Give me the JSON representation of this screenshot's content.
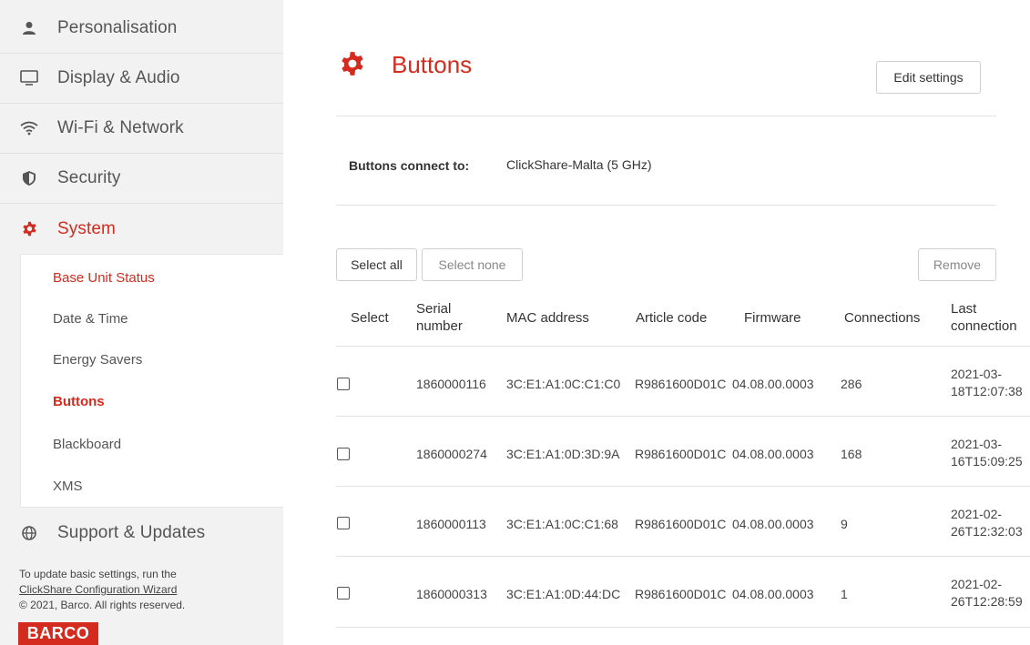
{
  "sidebar": {
    "nav": [
      {
        "label": "Personalisation",
        "icon": "person-icon"
      },
      {
        "label": "Display & Audio",
        "icon": "monitor-icon"
      },
      {
        "label": "Wi-Fi & Network",
        "icon": "wifi-icon"
      },
      {
        "label": "Security",
        "icon": "shield-icon"
      },
      {
        "label": "System",
        "icon": "gear-icon"
      }
    ],
    "submenu": [
      {
        "label": "Base Unit Status"
      },
      {
        "label": "Date & Time"
      },
      {
        "label": "Energy Savers"
      },
      {
        "label": "Buttons"
      },
      {
        "label": "Blackboard"
      },
      {
        "label": "XMS"
      }
    ],
    "support": {
      "label": "Support & Updates",
      "icon": "globe-icon"
    },
    "footer": {
      "line1": "To update basic settings, run the",
      "link": "ClickShare Configuration Wizard",
      "copyright": "© 2021, Barco. All rights reserved.",
      "logo": "BARCO"
    }
  },
  "main": {
    "title": "Buttons",
    "edit_settings": "Edit settings",
    "connect_label": "Buttons connect to:",
    "connect_value": "ClickShare-Malta (5 GHz)",
    "select_all": "Select all",
    "select_none": "Select none",
    "remove": "Remove",
    "columns": {
      "select": "Select",
      "serial": "Serial number",
      "mac": "MAC address",
      "article": "Article code",
      "firmware": "Firmware",
      "connections": "Connections",
      "last": "Last connection"
    },
    "rows": [
      {
        "serial": "1860000116",
        "mac": "3C:E1:A1:0C:C1:C0",
        "article": "R9861600D01C",
        "firmware": "04.08.00.0003",
        "connections": "286",
        "last_date": "2021-03-",
        "last_time": "18T12:07:38"
      },
      {
        "serial": "1860000274",
        "mac": "3C:E1:A1:0D:3D:9A",
        "article": "R9861600D01C",
        "firmware": "04.08.00.0003",
        "connections": "168",
        "last_date": "2021-03-",
        "last_time": "16T15:09:25"
      },
      {
        "serial": "1860000113",
        "mac": "3C:E1:A1:0C:C1:68",
        "article": "R9861600D01C",
        "firmware": "04.08.00.0003",
        "connections": "9",
        "last_date": "2021-02-",
        "last_time": "26T12:32:03"
      },
      {
        "serial": "1860000313",
        "mac": "3C:E1:A1:0D:44:DC",
        "article": "R9861600D01C",
        "firmware": "04.08.00.0003",
        "connections": "1",
        "last_date": "2021-02-",
        "last_time": "26T12:28:59"
      }
    ]
  },
  "colors": {
    "accent": "#d52b1e",
    "sidebar_bg": "#f2f2f2"
  }
}
